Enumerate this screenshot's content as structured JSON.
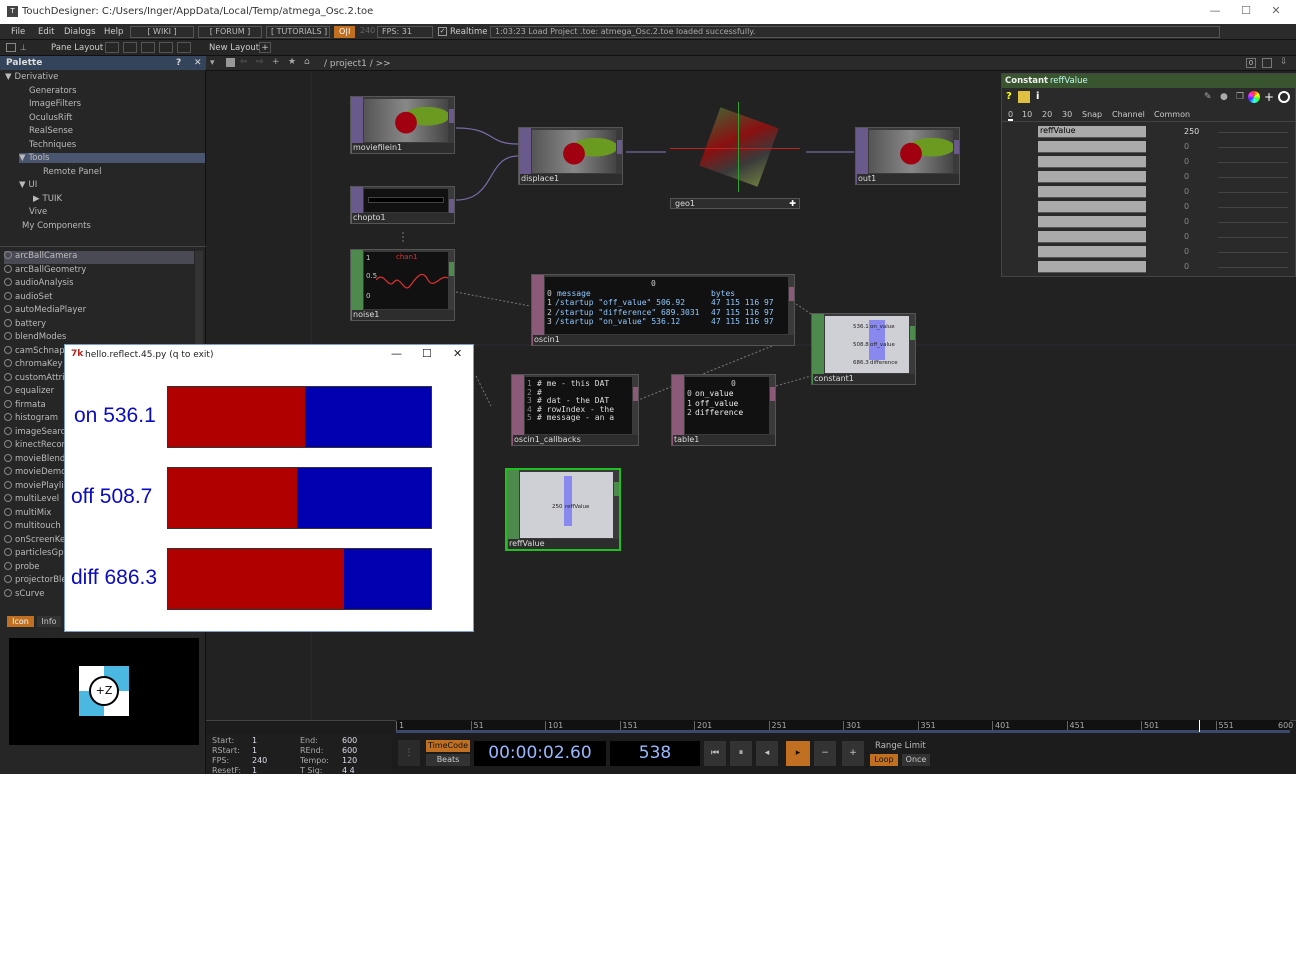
{
  "window": {
    "title": "TouchDesigner: C:/Users/Inger/AppData/Local/Temp/atmega_Osc.2.toe",
    "minimize": "—",
    "maximize": "☐",
    "close": "✕"
  },
  "menu": {
    "items": [
      "File",
      "Edit",
      "Dialogs",
      "Help"
    ],
    "wiki": "[ WIKI ]",
    "forum": "[ FORUM ]",
    "tutorials": "[ TUTORIALS ]",
    "oi": "O|I",
    "fps_cap": "240",
    "fps_label": "FPS:",
    "fps_value": "31",
    "realtime": "Realtime",
    "status": "1:03:23 Load Project .toe: atmega_Osc.2.toe loaded successfully."
  },
  "toolbar": {
    "pane_layout": "Pane Layout",
    "new_layout": "New Layout",
    "plus": "+"
  },
  "palette": {
    "title": "Palette",
    "help": "?",
    "close": "✕",
    "tree": [
      {
        "label": "Derivative",
        "indent": 0,
        "arrow": "▼"
      },
      {
        "label": "Generators",
        "indent": 2,
        "arrow": ""
      },
      {
        "label": "ImageFilters",
        "indent": 2,
        "arrow": ""
      },
      {
        "label": "OculusRift",
        "indent": 2,
        "arrow": ""
      },
      {
        "label": "RealSense",
        "indent": 2,
        "arrow": ""
      },
      {
        "label": "Techniques",
        "indent": 2,
        "arrow": ""
      },
      {
        "label": "Tools",
        "indent": 2,
        "arrow": "▼"
      },
      {
        "label": "Remote Panel",
        "indent": 4,
        "arrow": ""
      },
      {
        "label": "UI",
        "indent": 2,
        "arrow": "▼"
      },
      {
        "label": "TUIK",
        "indent": 4,
        "arrow": "▶"
      },
      {
        "label": "Vive",
        "indent": 2,
        "arrow": ""
      },
      {
        "label": "My Components",
        "indent": 1,
        "arrow": ""
      }
    ],
    "components": [
      "arcBallCamera",
      "arcBallGeometry",
      "audioAnalysis",
      "audioSet",
      "autoMediaPlayer",
      "battery",
      "blendModes",
      "camSchnapp",
      "chromaKey",
      "customAttrib",
      "equalizer",
      "firmata",
      "histogram",
      "imageSearch",
      "kinectRecord",
      "movieBlend",
      "movieDemo",
      "moviePlaylist",
      "multiLevel",
      "multiMix",
      "multitouch",
      "onScreenKe",
      "particlesGpu",
      "probe",
      "projectorBle",
      "sCurve"
    ],
    "tabs": [
      "Icon",
      "Info"
    ],
    "preview_icon": "+Z"
  },
  "network": {
    "path": "/ project1 / >>",
    "nodes": {
      "moviefilein1": "moviefilein1",
      "displace1": "displace1",
      "geo1": "geo1",
      "out1": "out1",
      "chopto1": "chopto1",
      "noise1": "noise1",
      "oscin1": "oscin1",
      "constant1": "constant1",
      "oscin1_callbacks": "oscin1_callbacks",
      "table1": "table1",
      "reffValue": "reffValue"
    },
    "noise_chart": {
      "label": "chan1",
      "ticks": [
        "1",
        "0.5",
        "0"
      ]
    },
    "oscin_table": {
      "col0": "0",
      "headers": [
        "message",
        "bytes"
      ],
      "rows": [
        {
          "i": "1",
          "message": "/startup \"off_value\" 506.92",
          "bytes": "47 115 116 97"
        },
        {
          "i": "2",
          "message": "/startup \"difference\" 689.3031",
          "bytes": "47 115 116 97"
        },
        {
          "i": "3",
          "message": "/startup \"on_value\" 536.12",
          "bytes": "47 115 116 97"
        }
      ]
    },
    "callbacks_text": [
      {
        "n": "1",
        "t": "# me - this DAT"
      },
      {
        "n": "2",
        "t": "#"
      },
      {
        "n": "3",
        "t": "# dat - the DAT"
      },
      {
        "n": "4",
        "t": "# rowIndex - the"
      },
      {
        "n": "5",
        "t": "# message - an a"
      }
    ],
    "table1": {
      "col0": "0",
      "rows": [
        {
          "i": "0",
          "v": "on_value"
        },
        {
          "i": "1",
          "v": "off_value"
        },
        {
          "i": "2",
          "v": "difference"
        }
      ]
    },
    "constant_view": [
      {
        "v": "536.1",
        "n": "on_value"
      },
      {
        "v": "508.8",
        "n": "off_value"
      },
      {
        "v": "686.3",
        "n": "difference"
      }
    ],
    "reff_view": {
      "v": "250",
      "n": "reffValue"
    }
  },
  "params": {
    "op_type": "Constant",
    "op_name": "reffValue",
    "tabs": [
      "0",
      "10",
      "20",
      "30",
      "Snap",
      "Channel",
      "Common"
    ],
    "rows": [
      {
        "name": "reffValue",
        "value": "250"
      },
      {
        "name": "",
        "value": "0"
      },
      {
        "name": "",
        "value": "0"
      },
      {
        "name": "",
        "value": "0"
      },
      {
        "name": "",
        "value": "0"
      },
      {
        "name": "",
        "value": "0"
      },
      {
        "name": "",
        "value": "0"
      },
      {
        "name": "",
        "value": "0"
      },
      {
        "name": "",
        "value": "0"
      },
      {
        "name": "",
        "value": "0"
      }
    ]
  },
  "timeline": {
    "ruler": [
      "1",
      "51",
      "101",
      "151",
      "201",
      "251",
      "301",
      "351",
      "401",
      "451",
      "501",
      "551",
      "600"
    ],
    "info": {
      "start_k": "Start:",
      "start_v": "1",
      "end_k": "End:",
      "end_v": "600",
      "rstart_k": "RStart:",
      "rstart_v": "1",
      "rend_k": "REnd:",
      "rend_v": "600",
      "fps_k": "FPS:",
      "fps_v": "240",
      "tempo_k": "Tempo:",
      "tempo_v": "120",
      "reset_k": "ResetF:",
      "reset_v": "1",
      "tsig_k": "T Sig:",
      "tsig_v": "4   4"
    },
    "timecode_btn": "TimeCode",
    "beats_btn": "Beats",
    "timecode": "00:00:02.60",
    "frame": "538",
    "range_limit": "Range Limit",
    "loop": "Loop",
    "once": "Once"
  },
  "python_window": {
    "title": "hello.reflect.45.py (q to exit)",
    "bars": [
      {
        "label": "on 536.1",
        "fraction": 0.52
      },
      {
        "label": "off 508.7",
        "fraction": 0.49
      },
      {
        "label": "diff 686.3",
        "fraction": 0.67
      }
    ],
    "colors": {
      "fill": "#b00000",
      "rest": "#0000b0",
      "text": "#0a0ac0"
    }
  }
}
